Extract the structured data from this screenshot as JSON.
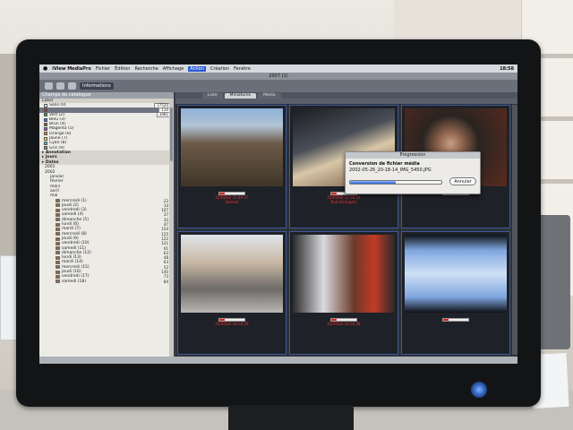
{
  "menubar": {
    "app_name": "iView MediaPro",
    "menus": [
      "Fichier",
      "Édition",
      "Recherche",
      "Affichage",
      "Action",
      "Création",
      "Fenêtre"
    ],
    "active_menu": "Action",
    "clock": "18:58"
  },
  "window": {
    "title": "2007 (1)"
  },
  "toolbar": {
    "info_label": "Informations"
  },
  "sidebar": {
    "header": "Champs du catalogue",
    "sub": "Label",
    "labels": [
      {
        "name": "Sans (0)",
        "color": "#ffffff",
        "count": "27520"
      },
      {
        "name": "",
        "color": "#cc2222",
        "count": "134",
        "selected": true
      },
      {
        "name": "Vert (2)",
        "color": "#33aa33",
        "count": "3481"
      },
      {
        "name": "Bleu (3)",
        "color": "#3366dd",
        "count": ""
      },
      {
        "name": "Brun (4)",
        "color": "#8b5a2b",
        "count": ""
      },
      {
        "name": "Magenta (5)",
        "color": "#cc33cc",
        "count": ""
      },
      {
        "name": "Orange (6)",
        "color": "#ee8822",
        "count": ""
      },
      {
        "name": "Jaune (7)",
        "color": "#eedd22",
        "count": ""
      },
      {
        "name": "Cyan (8)",
        "color": "#33cccc",
        "count": ""
      },
      {
        "name": "Gris (9)",
        "color": "#888888",
        "count": ""
      }
    ],
    "groups": [
      "Annotation",
      "Jours",
      "Dates"
    ],
    "tree": [
      {
        "name": "2001",
        "n": ""
      },
      {
        "name": "2002",
        "n": ""
      },
      {
        "name": "janvier",
        "n": ""
      },
      {
        "name": "février",
        "n": ""
      },
      {
        "name": "mars",
        "n": ""
      },
      {
        "name": "avril",
        "n": ""
      },
      {
        "name": "mai",
        "n": ""
      },
      {
        "name": "mercredi (1)",
        "n": "23"
      },
      {
        "name": "jeudi (2)",
        "n": "14"
      },
      {
        "name": "vendredi (3)",
        "n": "107"
      },
      {
        "name": "samedi (4)",
        "n": "37"
      },
      {
        "name": "dimanche (5)",
        "n": "33"
      },
      {
        "name": "lundi (6)",
        "n": "47"
      },
      {
        "name": "mardi (7)",
        "n": "154"
      },
      {
        "name": "mercredi (8)",
        "n": "125"
      },
      {
        "name": "jeudi (9)",
        "n": "122"
      },
      {
        "name": "vendredi (10)",
        "n": "121"
      },
      {
        "name": "samedi (11)",
        "n": "61"
      },
      {
        "name": "dimanche (12)",
        "n": "63"
      },
      {
        "name": "lundi (13)",
        "n": "48"
      },
      {
        "name": "mardi (14)",
        "n": "63"
      },
      {
        "name": "mercredi (15)",
        "n": "52"
      },
      {
        "name": "jeudi (16)",
        "n": "140"
      },
      {
        "name": "vendredi (17)",
        "n": "73"
      },
      {
        "name": "samedi (18)",
        "n": "84"
      }
    ]
  },
  "main": {
    "tabs": [
      "Liste",
      "Miniatures",
      "Média"
    ],
    "active_tab": "Miniatures",
    "cells": [
      {
        "date": "25/05/02 15:49:47",
        "label": "Samedi",
        "img": "img1",
        "rating": 0.2
      },
      {
        "date": "25/05/02 15:58:28",
        "label": "Nuit étrangère",
        "img": "img2",
        "rating": 0.2
      },
      {
        "date": "",
        "label": "",
        "img": "img3",
        "rating": 0.2
      },
      {
        "date": "25/05/02 18:20:29",
        "label": "",
        "img": "img4",
        "rating": 0.2
      },
      {
        "date": "25/05/02 18:24:38",
        "label": "",
        "img": "img5",
        "rating": 0.2
      },
      {
        "date": "",
        "label": "",
        "img": "img6",
        "rating": 0.2
      }
    ]
  },
  "dialog": {
    "title": "Progression",
    "line1": "Conversion de fichier média",
    "line2": "2002-05-26_20-18-14_IMG_5450.JPG",
    "progress": 0.5,
    "cancel_label": "Annuler"
  }
}
